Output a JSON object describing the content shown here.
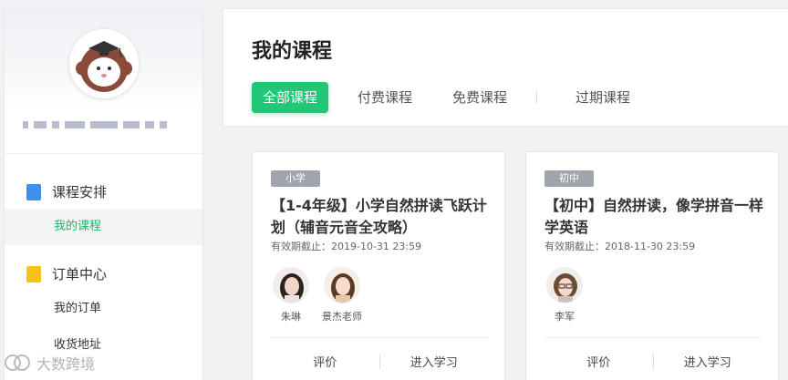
{
  "sidebar": {
    "sections": [
      {
        "label": "课程安排",
        "icon": "book-icon",
        "color": "#3d8ff0",
        "items": [
          {
            "label": "我的课程",
            "active": true
          }
        ]
      },
      {
        "label": "订单中心",
        "icon": "note-icon",
        "color": "#f5c21b",
        "items": [
          {
            "label": "我的订单",
            "active": false
          },
          {
            "label": "收货地址",
            "active": false
          }
        ]
      }
    ]
  },
  "main": {
    "title": "我的课程",
    "tabs": [
      {
        "label": "全部课程",
        "active": true
      },
      {
        "label": "付费课程",
        "active": false
      },
      {
        "label": "免费课程",
        "active": false
      },
      {
        "label": "过期课程",
        "active": false
      }
    ]
  },
  "courses": [
    {
      "badge": "小学",
      "title": "【1-4年级】小学自然拼读飞跃计划（辅音元音全攻略）",
      "expiry": "有效期截止：2019-10-31 23:59",
      "teachers": [
        {
          "name": "朱琳"
        },
        {
          "name": "景杰老师"
        }
      ],
      "review_label": "评价",
      "study_label": "进入学习"
    },
    {
      "badge": "初中",
      "title": "【初中】自然拼读，像学拼音一样学英语",
      "expiry": "有效期截止：2018-11-30 23:59",
      "teachers": [
        {
          "name": "李军"
        }
      ],
      "review_label": "评价",
      "study_label": "进入学习"
    }
  ],
  "accent_color": "#1fc777",
  "watermark": "大数跨境"
}
